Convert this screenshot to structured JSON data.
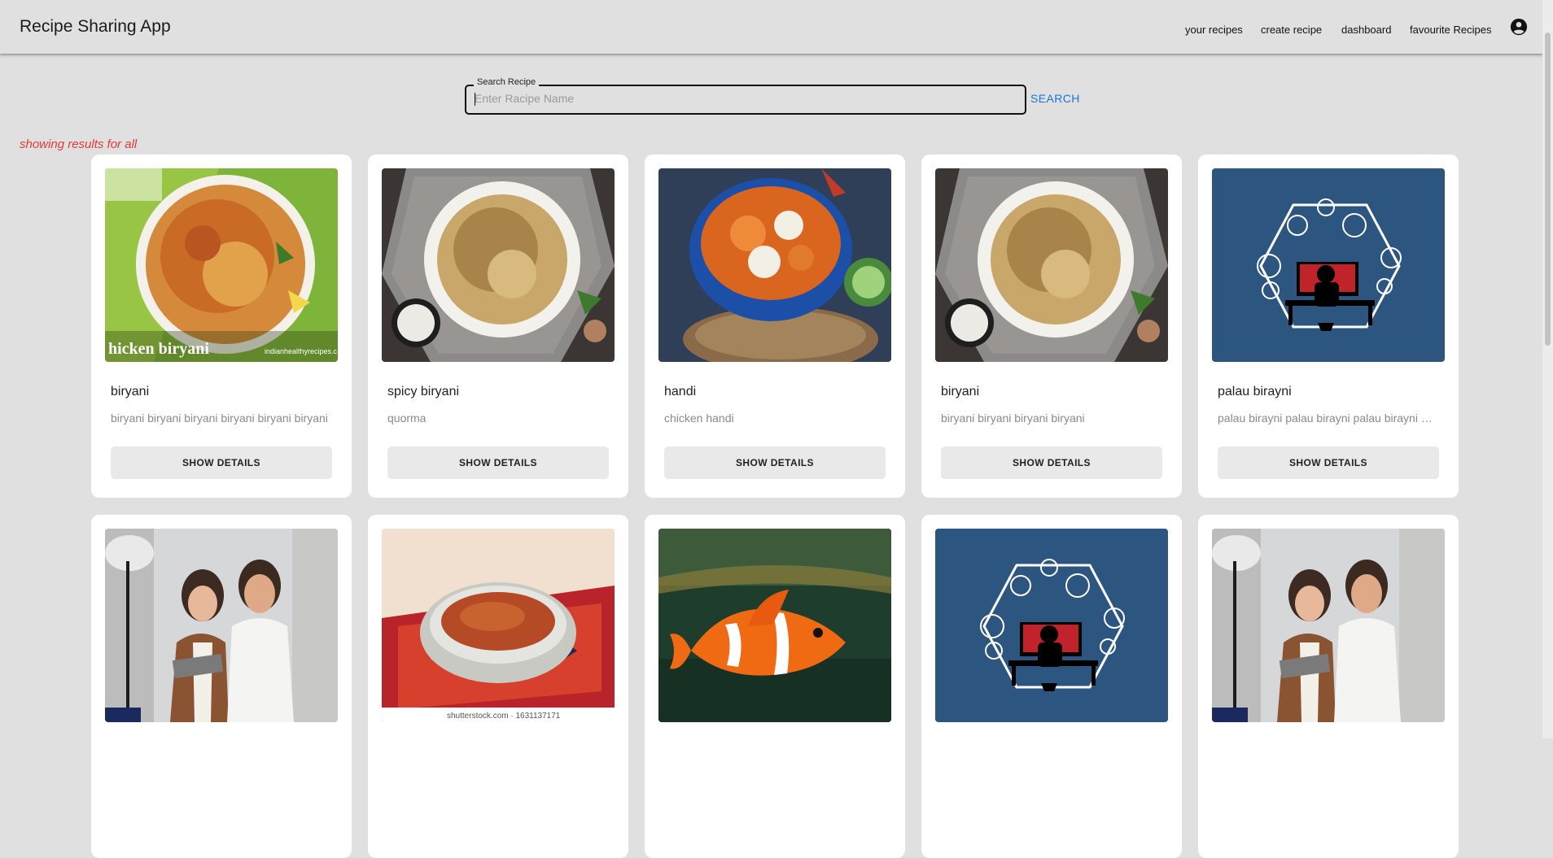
{
  "app": {
    "title": "Recipe Sharing App"
  },
  "nav": [
    {
      "label": "your recipes"
    },
    {
      "label": "create recipe"
    },
    {
      "label": "dashboard"
    },
    {
      "label": "favourite Recipes"
    }
  ],
  "account": {
    "icon": "account-circle-icon"
  },
  "search": {
    "label": "Search Recipe",
    "placeholder": "Enter Racipe Name",
    "value": "",
    "button_label": "SEARCH"
  },
  "results_note": "showing results for all",
  "recipes": [
    {
      "title": "biryani",
      "description": "biryani biryani biryani biryani biryani biryani",
      "button_label": "SHOW DETAILS",
      "image": "chicken-biryani-photo",
      "image_caption": "hicken biryani",
      "image_watermark": "indianhealthyrecipes.c"
    },
    {
      "title": "spicy biryani",
      "description": "quorma",
      "button_label": "SHOW DETAILS",
      "image": "biryani-plate-photo"
    },
    {
      "title": "handi",
      "description": "chicken handi",
      "button_label": "SHOW DETAILS",
      "image": "paneer-curry-bowl-photo"
    },
    {
      "title": "biryani",
      "description": "biryani biryani biryani biryani",
      "button_label": "SHOW DETAILS",
      "image": "biryani-plate-photo"
    },
    {
      "title": "palau birayni",
      "description": "palau birayni palau birayni palau birayni palau birayni",
      "button_label": "SHOW DETAILS",
      "image": "computer-workstation-illustration"
    },
    {
      "title": "",
      "description": "",
      "button_label": "",
      "image": "business-people-photo"
    },
    {
      "title": "",
      "description": "",
      "button_label": "",
      "image": "soup-bowl-photo",
      "image_watermark": "shutterstock.com · 1631137171"
    },
    {
      "title": "",
      "description": "",
      "button_label": "",
      "image": "clownfish-photo"
    },
    {
      "title": "",
      "description": "",
      "button_label": "",
      "image": "computer-workstation-illustration"
    },
    {
      "title": "",
      "description": "",
      "button_label": "",
      "image": "business-people-photo"
    }
  ]
}
